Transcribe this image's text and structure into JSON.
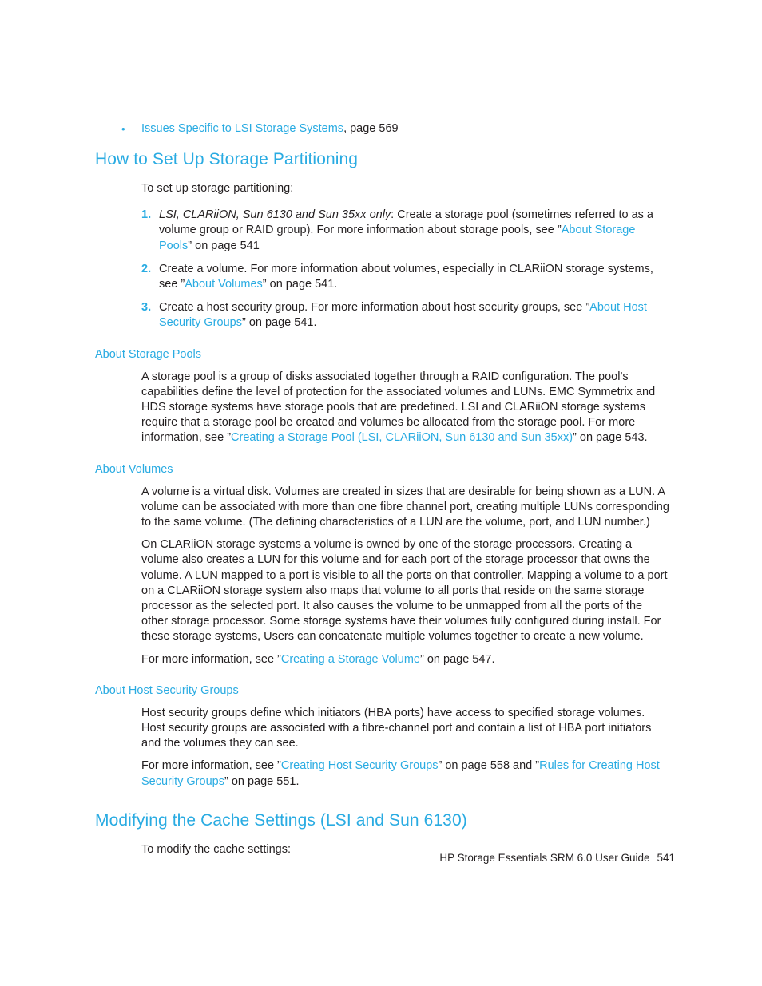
{
  "colors": {
    "link": "#29abe2",
    "heading": "#29abe2",
    "body": "#231f20"
  },
  "top_bullet": {
    "bullet_glyph": "•",
    "link_text": "Issues Specific to LSI Storage Systems",
    "tail_text": ", page 569"
  },
  "section_partitioning": {
    "heading": "How to Set Up Storage Partitioning",
    "lead": "To set up storage partitioning:",
    "steps": [
      {
        "number": "1.",
        "italic_lead": "LSI, CLARiiON, Sun 6130 and Sun 35xx only",
        "text_a": ": Create a storage pool (sometimes referred to as a volume group or RAID group). For more information about storage pools, see ”",
        "link": "About Storage Pools",
        "text_b": "” on page 541"
      },
      {
        "number": "2.",
        "italic_lead": "",
        "text_a": "Create a volume. For more information about volumes, especially in CLARiiON storage systems, see ”",
        "link": "About Volumes",
        "text_b": "” on page 541."
      },
      {
        "number": "3.",
        "italic_lead": "",
        "text_a": "Create a host security group. For more information about host security groups, see ”",
        "link": "About Host Security Groups",
        "text_b": "” on page 541."
      }
    ]
  },
  "section_storage_pools": {
    "heading": "About Storage Pools",
    "para_a": "A storage pool is a group of disks associated together through a RAID configuration. The pool’s capabilities define the level of protection for the associated volumes and LUNs. EMC Symmetrix and HDS storage systems have storage pools that are predefined. LSI and CLARiiON storage systems require that a storage pool be created and volumes be allocated from the storage pool. For more information, see ”",
    "link": "Creating a Storage Pool (LSI, CLARiiON, Sun 6130 and Sun 35xx)",
    "para_b": "” on page 543."
  },
  "section_volumes": {
    "heading": "About Volumes",
    "para_1": "A volume is a virtual disk. Volumes are created in sizes that are desirable for being shown as a LUN. A volume can be associated with more than one fibre channel port, creating multiple LUNs corresponding to the same volume. (The defining characteristics of a LUN are the volume, port, and LUN number.)",
    "para_2": "On CLARiiON storage systems a volume is owned by one of the storage processors. Creating a volume also creates a LUN for this volume and for each port of the storage processor that owns the volume. A LUN mapped to a port is visible to all the ports on that controller. Mapping a volume to a port on a CLARiiON storage system also maps that volume to all ports that reside on the same storage processor as the selected port. It also causes the volume to be unmapped from all the ports of the other storage processor. Some storage systems have their volumes fully configured during install. For these storage systems, Users can concatenate multiple volumes together to create a new volume.",
    "para_3_a": "For more information, see ”",
    "para_3_link": "Creating a Storage Volume",
    "para_3_b": "” on page 547."
  },
  "section_host_security_groups": {
    "heading": "About Host Security Groups",
    "para_1": "Host security groups define which initiators (HBA ports) have access to specified storage volumes. Host security groups are associated with a fibre-channel port and contain a list of HBA port initiators and the volumes they can see.",
    "para_2_a": "For more information, see ”",
    "para_2_link_1": "Creating Host Security Groups",
    "para_2_mid": "” on page 558 and ”",
    "para_2_link_2": "Rules for Creating Host Security Groups",
    "para_2_b": "” on page 551."
  },
  "section_cache": {
    "heading": "Modifying the Cache Settings (LSI and Sun 6130)",
    "lead": "To modify the cache settings:"
  },
  "footer": {
    "guide_title": "HP Storage Essentials SRM 6.0 User Guide",
    "page_number": "541"
  }
}
